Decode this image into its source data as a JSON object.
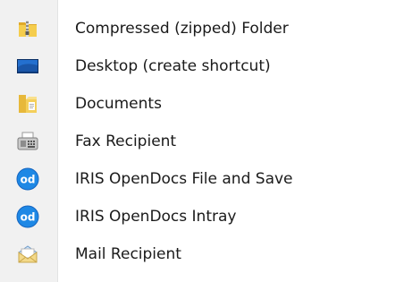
{
  "menu": {
    "items": [
      {
        "label": "Compressed (zipped) Folder",
        "icon": "zipped-folder-icon"
      },
      {
        "label": "Desktop (create shortcut)",
        "icon": "desktop-icon"
      },
      {
        "label": "Documents",
        "icon": "documents-library-icon"
      },
      {
        "label": "Fax Recipient",
        "icon": "fax-icon"
      },
      {
        "label": "IRIS OpenDocs File and Save",
        "icon": "opendocs-icon"
      },
      {
        "label": "IRIS OpenDocs Intray",
        "icon": "opendocs-icon"
      },
      {
        "label": "Mail Recipient",
        "icon": "mail-icon"
      }
    ]
  },
  "colors": {
    "gutter": "#f1f1f1",
    "separator": "#e2e3e3",
    "opendocs_blue": "#1e88e5",
    "folder_yellow": "#f2c23a",
    "desktop_blue": "#1f5fb8"
  }
}
